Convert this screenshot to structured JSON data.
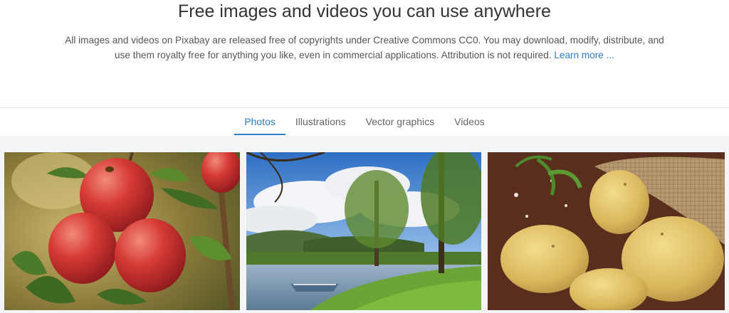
{
  "hero": {
    "title": "Free images and videos you can use anywhere",
    "description": "All images and videos on Pixabay are released free of copyrights under Creative Commons CC0. You may download, modify, distribute, and use them royalty free for anything you like, even in commercial applications. Attribution is not required.",
    "learn_more": "Learn more ..."
  },
  "tabs": [
    {
      "label": "Photos",
      "active": true
    },
    {
      "label": "Illustrations",
      "active": false
    },
    {
      "label": "Vector graphics",
      "active": false
    },
    {
      "label": "Videos",
      "active": false
    }
  ],
  "gallery": {
    "photos": [
      {
        "subject": "red-apples"
      },
      {
        "subject": "lake-landscape-with-boat"
      },
      {
        "subject": "potatoes-in-burlap-sack"
      }
    ]
  },
  "colors": {
    "accent": "#2d7cc4",
    "gallery_background": "#f4f5f7"
  }
}
